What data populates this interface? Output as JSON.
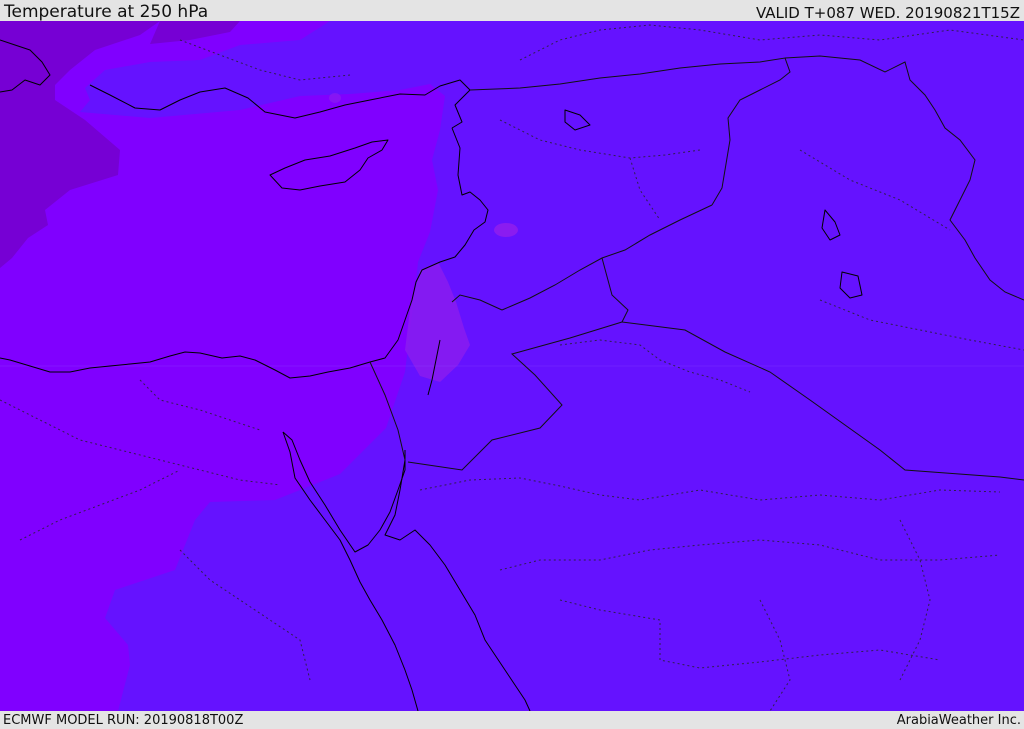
{
  "header": {
    "title": "Temperature at 250 hPa",
    "valid_time": "VALID T+087 WED. 20190821T15Z"
  },
  "footer": {
    "model_run": "ECMWF MODEL RUN: 20190818T00Z",
    "credit": "ArabiaWeather Inc."
  },
  "map": {
    "field": "temperature",
    "level": "250 hPa",
    "colors": {
      "coldest_zone": "#7600d4",
      "cold_zone": "#8000ff",
      "base_zone": "#6512ff",
      "warm_patch": "#8a1cf0",
      "coastline": "#000000",
      "border_internal": "#222222"
    }
  }
}
